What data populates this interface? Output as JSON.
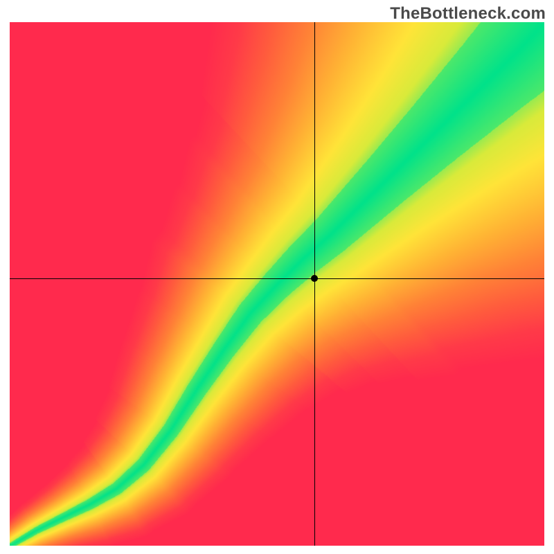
{
  "watermark": "TheBottleneck.com",
  "chart_data": {
    "type": "heatmap",
    "title": "",
    "xlabel": "",
    "ylabel": "",
    "xlim": [
      0,
      100
    ],
    "ylim": [
      0,
      100
    ],
    "crosshair": {
      "x": 57,
      "y": 51
    },
    "marker_radius_px": 5,
    "colorscale": [
      {
        "t": 0.0,
        "color": "#00e28a"
      },
      {
        "t": 0.08,
        "color": "#66ea60"
      },
      {
        "t": 0.15,
        "color": "#d9ea3a"
      },
      {
        "t": 0.25,
        "color": "#ffe438"
      },
      {
        "t": 0.4,
        "color": "#ffb334"
      },
      {
        "t": 0.55,
        "color": "#ff8336"
      },
      {
        "t": 0.7,
        "color": "#ff5c3d"
      },
      {
        "t": 0.85,
        "color": "#ff3a48"
      },
      {
        "t": 1.0,
        "color": "#ff2a4d"
      }
    ],
    "diagonal_curve": {
      "description": "Optimal-match ridge as normalized (x,y) control points; green band centers on this curve",
      "points": [
        [
          0.0,
          0.0
        ],
        [
          0.05,
          0.03
        ],
        [
          0.1,
          0.055
        ],
        [
          0.15,
          0.08
        ],
        [
          0.2,
          0.11
        ],
        [
          0.25,
          0.155
        ],
        [
          0.3,
          0.22
        ],
        [
          0.35,
          0.3
        ],
        [
          0.4,
          0.375
        ],
        [
          0.45,
          0.445
        ],
        [
          0.5,
          0.5
        ],
        [
          0.55,
          0.55
        ],
        [
          0.6,
          0.595
        ],
        [
          0.65,
          0.645
        ],
        [
          0.7,
          0.695
        ],
        [
          0.75,
          0.745
        ],
        [
          0.8,
          0.795
        ],
        [
          0.85,
          0.845
        ],
        [
          0.9,
          0.895
        ],
        [
          0.95,
          0.945
        ],
        [
          1.0,
          1.0
        ]
      ]
    },
    "band_halfwidth": {
      "description": "Half-thickness of green band perpendicular to curve, as fraction of canvas, vs position along curve",
      "points": [
        [
          0.0,
          0.005
        ],
        [
          0.1,
          0.008
        ],
        [
          0.2,
          0.012
        ],
        [
          0.3,
          0.016
        ],
        [
          0.4,
          0.022
        ],
        [
          0.5,
          0.03
        ],
        [
          0.6,
          0.04
        ],
        [
          0.7,
          0.052
        ],
        [
          0.8,
          0.066
        ],
        [
          0.9,
          0.082
        ],
        [
          1.0,
          0.1
        ]
      ]
    }
  }
}
